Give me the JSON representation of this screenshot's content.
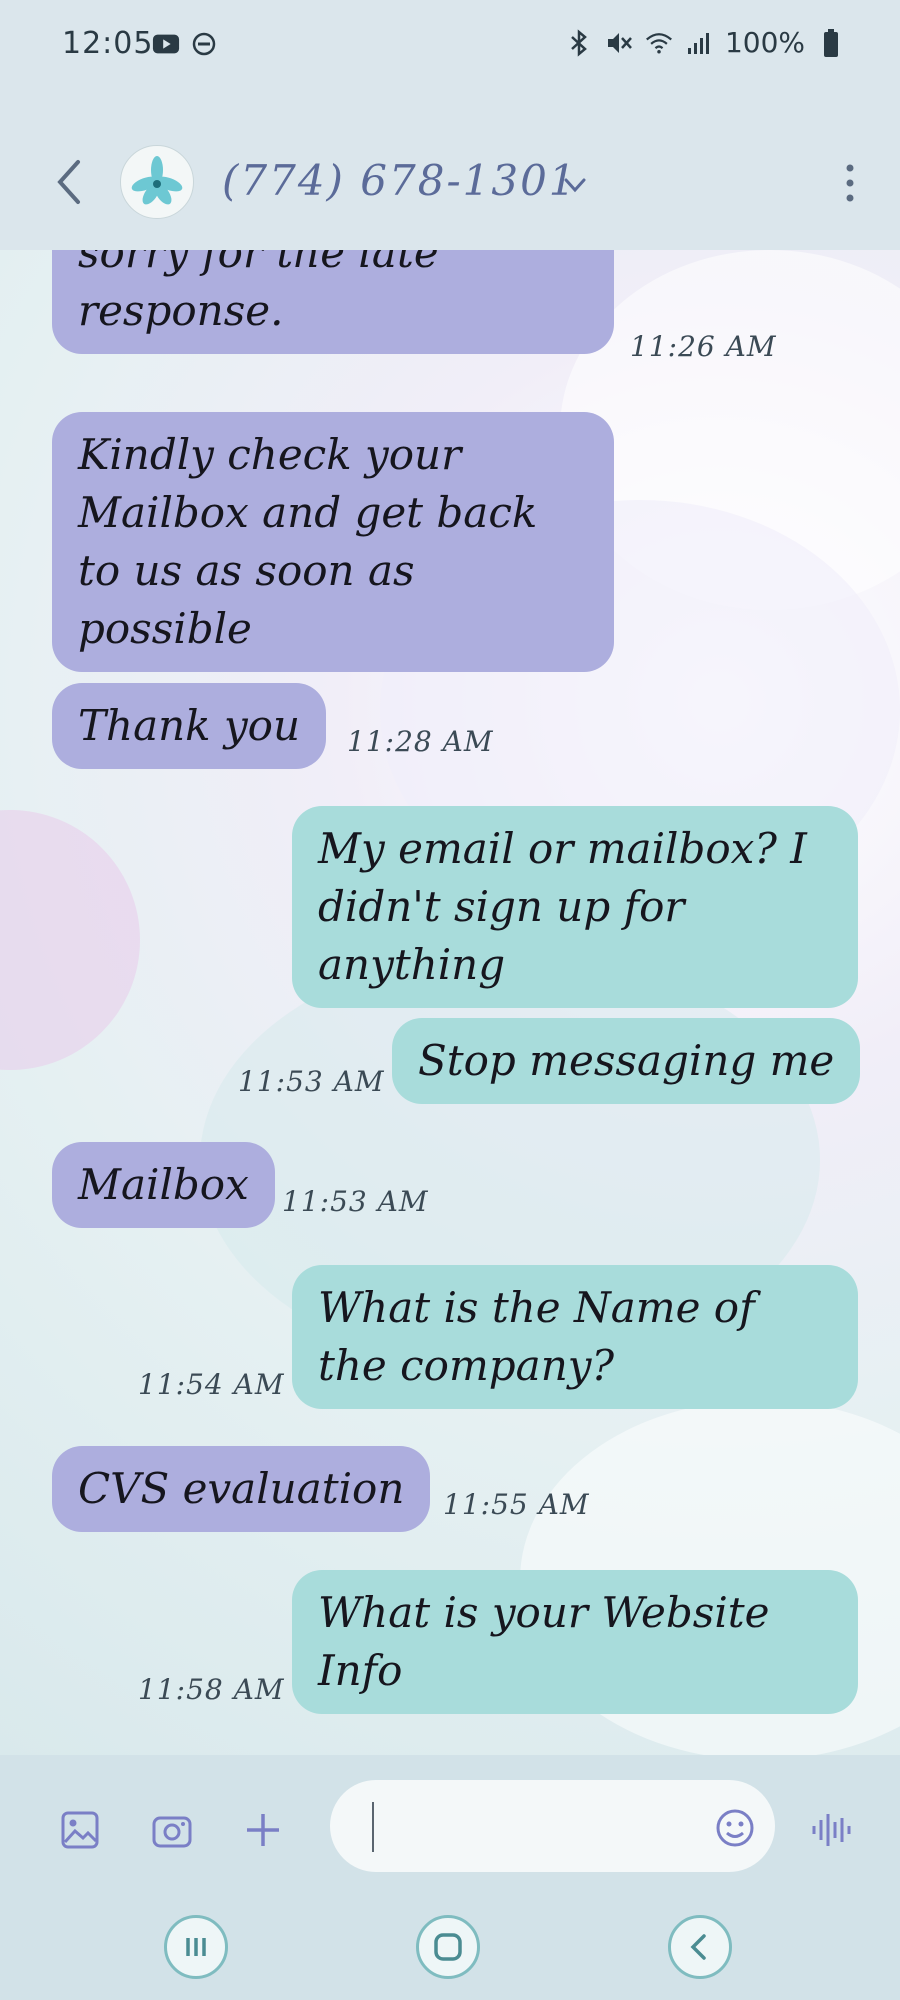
{
  "status": {
    "time": "12:05",
    "battery": "100%",
    "icons_left": [
      "youtube-icon",
      "dnd-icon"
    ],
    "icons_right": [
      "bluetooth-icon",
      "mute-icon",
      "wifi-icon",
      "signal-icon",
      "battery-icon"
    ]
  },
  "header": {
    "contact": "(774) 678-1301"
  },
  "messages": [
    {
      "dir": "in",
      "text": "sorry for the late response.",
      "time": "11:26 AM"
    },
    {
      "dir": "in",
      "text": "Kindly check your Mailbox and get back to us as soon as possible",
      "time": ""
    },
    {
      "dir": "in",
      "text": "Thank you",
      "time": "11:28 AM"
    },
    {
      "dir": "out",
      "text": "My email or mailbox? I didn't sign up for anything",
      "time": ""
    },
    {
      "dir": "out",
      "text": "Stop messaging me",
      "time": "11:53 AM"
    },
    {
      "dir": "in",
      "text": "Mailbox",
      "time": "11:53 AM"
    },
    {
      "dir": "out",
      "text": "What is the Name of the company?",
      "time": "11:54 AM"
    },
    {
      "dir": "in",
      "text": "CVS evaluation",
      "time": "11:55 AM"
    },
    {
      "dir": "out",
      "text": "What is your Website Info",
      "time": "11:58 AM"
    }
  ],
  "composer": {
    "placeholder": "",
    "icons": [
      "gallery-icon",
      "camera-icon",
      "plus-icon",
      "emoji-icon",
      "voice-icon"
    ]
  },
  "colors": {
    "incoming_bubble": "#adaede",
    "outgoing_bubble": "#a8dcdb",
    "accent": "#5b6b99"
  }
}
